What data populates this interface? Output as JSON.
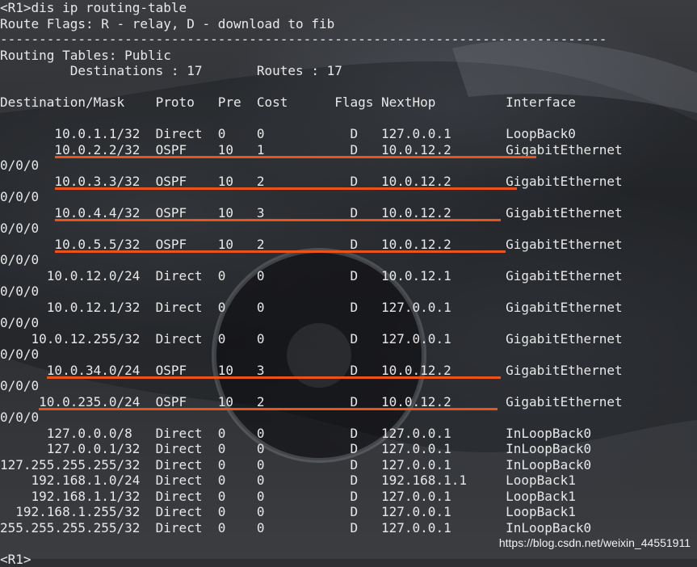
{
  "terminal": {
    "lines": [
      "<R1>dis ip routing-table",
      "Route Flags: R - relay, D - download to fib",
      "------------------------------------------------------------------------------",
      "Routing Tables: Public",
      "         Destinations : 17       Routes : 17",
      "",
      "Destination/Mask    Proto   Pre  Cost      Flags NextHop         Interface",
      "",
      "       10.0.1.1/32  Direct  0    0           D   127.0.0.1       LoopBack0",
      "       10.0.2.2/32  OSPF    10   1           D   10.0.12.2       GigabitEthernet",
      "0/0/0",
      "       10.0.3.3/32  OSPF    10   2           D   10.0.12.2       GigabitEthernet",
      "0/0/0",
      "       10.0.4.4/32  OSPF    10   3           D   10.0.12.2       GigabitEthernet",
      "0/0/0",
      "       10.0.5.5/32  OSPF    10   2           D   10.0.12.2       GigabitEthernet",
      "0/0/0",
      "      10.0.12.0/24  Direct  0    0           D   10.0.12.1       GigabitEthernet",
      "0/0/0",
      "      10.0.12.1/32  Direct  0    0           D   127.0.0.1       GigabitEthernet",
      "0/0/0",
      "    10.0.12.255/32  Direct  0    0           D   127.0.0.1       GigabitEthernet",
      "0/0/0",
      "      10.0.34.0/24  OSPF    10   3           D   10.0.12.2       GigabitEthernet",
      "0/0/0",
      "     10.0.235.0/24  OSPF    10   2           D   10.0.12.2       GigabitEthernet",
      "0/0/0",
      "      127.0.0.0/8   Direct  0    0           D   127.0.0.1       InLoopBack0",
      "      127.0.0.1/32  Direct  0    0           D   127.0.0.1       InLoopBack0",
      "127.255.255.255/32  Direct  0    0           D   127.0.0.1       InLoopBack0",
      "    192.168.1.0/24  Direct  0    0           D   192.168.1.1     LoopBack1",
      "    192.168.1.1/32  Direct  0    0           D   127.0.0.1       LoopBack1",
      "  192.168.1.255/32  Direct  0    0           D   127.0.0.1       LoopBack1",
      "255.255.255.255/32  Direct  0    0           D   127.0.0.1       InLoopBack0",
      "",
      "<R1>"
    ]
  },
  "watermark": "https://blog.csdn.net/weixin_44551911",
  "colors": {
    "text": "#e8e8e8",
    "underline": "#e8541a"
  }
}
